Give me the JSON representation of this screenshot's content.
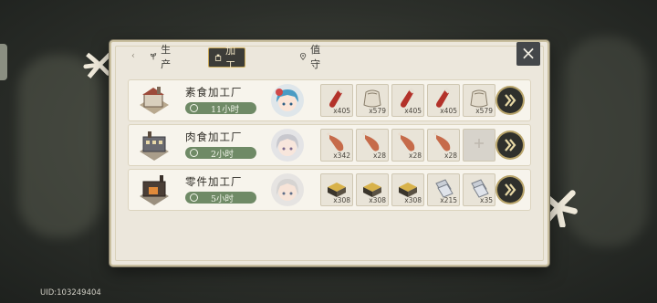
{
  "tabs": [
    {
      "label": "生产",
      "icon": "sprout-icon",
      "active": false
    },
    {
      "label": "加工",
      "icon": "factory-icon",
      "active": true
    },
    {
      "label": "值守",
      "icon": "location-pin-icon",
      "active": false
    }
  ],
  "close_icon": "close-icon",
  "factories": [
    {
      "name": "素食加工厂",
      "time": "11小时",
      "items": [
        {
          "icon": "ketchup-bottle-icon",
          "qty": "x405"
        },
        {
          "icon": "flour-sack-icon",
          "qty": "x579"
        },
        {
          "icon": "ketchup-bottle-icon",
          "qty": "x405"
        },
        {
          "icon": "ketchup-bottle-icon",
          "qty": "x405"
        },
        {
          "icon": "flour-sack-icon",
          "qty": "x579"
        }
      ]
    },
    {
      "name": "肉食加工厂",
      "time": "2小时",
      "items": [
        {
          "icon": "ham-leg-icon",
          "qty": "x342"
        },
        {
          "icon": "ham-leg-icon",
          "qty": "x28"
        },
        {
          "icon": "ham-leg-icon",
          "qty": "x28"
        },
        {
          "icon": "ham-leg-icon",
          "qty": "x28"
        },
        {
          "icon": "empty-slot-icon",
          "qty": ""
        }
      ]
    },
    {
      "name": "零件加工厂",
      "time": "5小时",
      "items": [
        {
          "icon": "parts-crate-icon",
          "qty": "x308"
        },
        {
          "icon": "parts-crate-icon",
          "qty": "x308"
        },
        {
          "icon": "parts-crate-icon",
          "qty": "x308"
        },
        {
          "icon": "metal-plates-icon",
          "qty": "x215"
        },
        {
          "icon": "metal-plates-icon",
          "qty": "x35"
        }
      ]
    }
  ],
  "uid": "UID:103249404"
}
